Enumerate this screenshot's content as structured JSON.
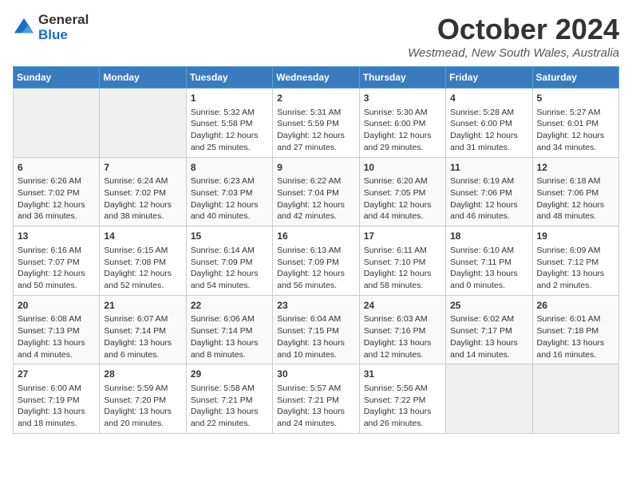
{
  "logo": {
    "general": "General",
    "blue": "Blue"
  },
  "title": "October 2024",
  "location": "Westmead, New South Wales, Australia",
  "days_of_week": [
    "Sunday",
    "Monday",
    "Tuesday",
    "Wednesday",
    "Thursday",
    "Friday",
    "Saturday"
  ],
  "weeks": [
    [
      {
        "day": "",
        "empty": true
      },
      {
        "day": "",
        "empty": true
      },
      {
        "day": "1",
        "sunrise": "Sunrise: 5:32 AM",
        "sunset": "Sunset: 5:58 PM",
        "daylight": "Daylight: 12 hours and 25 minutes."
      },
      {
        "day": "2",
        "sunrise": "Sunrise: 5:31 AM",
        "sunset": "Sunset: 5:59 PM",
        "daylight": "Daylight: 12 hours and 27 minutes."
      },
      {
        "day": "3",
        "sunrise": "Sunrise: 5:30 AM",
        "sunset": "Sunset: 6:00 PM",
        "daylight": "Daylight: 12 hours and 29 minutes."
      },
      {
        "day": "4",
        "sunrise": "Sunrise: 5:28 AM",
        "sunset": "Sunset: 6:00 PM",
        "daylight": "Daylight: 12 hours and 31 minutes."
      },
      {
        "day": "5",
        "sunrise": "Sunrise: 5:27 AM",
        "sunset": "Sunset: 6:01 PM",
        "daylight": "Daylight: 12 hours and 34 minutes."
      }
    ],
    [
      {
        "day": "6",
        "sunrise": "Sunrise: 6:26 AM",
        "sunset": "Sunset: 7:02 PM",
        "daylight": "Daylight: 12 hours and 36 minutes."
      },
      {
        "day": "7",
        "sunrise": "Sunrise: 6:24 AM",
        "sunset": "Sunset: 7:02 PM",
        "daylight": "Daylight: 12 hours and 38 minutes."
      },
      {
        "day": "8",
        "sunrise": "Sunrise: 6:23 AM",
        "sunset": "Sunset: 7:03 PM",
        "daylight": "Daylight: 12 hours and 40 minutes."
      },
      {
        "day": "9",
        "sunrise": "Sunrise: 6:22 AM",
        "sunset": "Sunset: 7:04 PM",
        "daylight": "Daylight: 12 hours and 42 minutes."
      },
      {
        "day": "10",
        "sunrise": "Sunrise: 6:20 AM",
        "sunset": "Sunset: 7:05 PM",
        "daylight": "Daylight: 12 hours and 44 minutes."
      },
      {
        "day": "11",
        "sunrise": "Sunrise: 6:19 AM",
        "sunset": "Sunset: 7:06 PM",
        "daylight": "Daylight: 12 hours and 46 minutes."
      },
      {
        "day": "12",
        "sunrise": "Sunrise: 6:18 AM",
        "sunset": "Sunset: 7:06 PM",
        "daylight": "Daylight: 12 hours and 48 minutes."
      }
    ],
    [
      {
        "day": "13",
        "sunrise": "Sunrise: 6:16 AM",
        "sunset": "Sunset: 7:07 PM",
        "daylight": "Daylight: 12 hours and 50 minutes."
      },
      {
        "day": "14",
        "sunrise": "Sunrise: 6:15 AM",
        "sunset": "Sunset: 7:08 PM",
        "daylight": "Daylight: 12 hours and 52 minutes."
      },
      {
        "day": "15",
        "sunrise": "Sunrise: 6:14 AM",
        "sunset": "Sunset: 7:09 PM",
        "daylight": "Daylight: 12 hours and 54 minutes."
      },
      {
        "day": "16",
        "sunrise": "Sunrise: 6:13 AM",
        "sunset": "Sunset: 7:09 PM",
        "daylight": "Daylight: 12 hours and 56 minutes."
      },
      {
        "day": "17",
        "sunrise": "Sunrise: 6:11 AM",
        "sunset": "Sunset: 7:10 PM",
        "daylight": "Daylight: 12 hours and 58 minutes."
      },
      {
        "day": "18",
        "sunrise": "Sunrise: 6:10 AM",
        "sunset": "Sunset: 7:11 PM",
        "daylight": "Daylight: 13 hours and 0 minutes."
      },
      {
        "day": "19",
        "sunrise": "Sunrise: 6:09 AM",
        "sunset": "Sunset: 7:12 PM",
        "daylight": "Daylight: 13 hours and 2 minutes."
      }
    ],
    [
      {
        "day": "20",
        "sunrise": "Sunrise: 6:08 AM",
        "sunset": "Sunset: 7:13 PM",
        "daylight": "Daylight: 13 hours and 4 minutes."
      },
      {
        "day": "21",
        "sunrise": "Sunrise: 6:07 AM",
        "sunset": "Sunset: 7:14 PM",
        "daylight": "Daylight: 13 hours and 6 minutes."
      },
      {
        "day": "22",
        "sunrise": "Sunrise: 6:06 AM",
        "sunset": "Sunset: 7:14 PM",
        "daylight": "Daylight: 13 hours and 8 minutes."
      },
      {
        "day": "23",
        "sunrise": "Sunrise: 6:04 AM",
        "sunset": "Sunset: 7:15 PM",
        "daylight": "Daylight: 13 hours and 10 minutes."
      },
      {
        "day": "24",
        "sunrise": "Sunrise: 6:03 AM",
        "sunset": "Sunset: 7:16 PM",
        "daylight": "Daylight: 13 hours and 12 minutes."
      },
      {
        "day": "25",
        "sunrise": "Sunrise: 6:02 AM",
        "sunset": "Sunset: 7:17 PM",
        "daylight": "Daylight: 13 hours and 14 minutes."
      },
      {
        "day": "26",
        "sunrise": "Sunrise: 6:01 AM",
        "sunset": "Sunset: 7:18 PM",
        "daylight": "Daylight: 13 hours and 16 minutes."
      }
    ],
    [
      {
        "day": "27",
        "sunrise": "Sunrise: 6:00 AM",
        "sunset": "Sunset: 7:19 PM",
        "daylight": "Daylight: 13 hours and 18 minutes."
      },
      {
        "day": "28",
        "sunrise": "Sunrise: 5:59 AM",
        "sunset": "Sunset: 7:20 PM",
        "daylight": "Daylight: 13 hours and 20 minutes."
      },
      {
        "day": "29",
        "sunrise": "Sunrise: 5:58 AM",
        "sunset": "Sunset: 7:21 PM",
        "daylight": "Daylight: 13 hours and 22 minutes."
      },
      {
        "day": "30",
        "sunrise": "Sunrise: 5:57 AM",
        "sunset": "Sunset: 7:21 PM",
        "daylight": "Daylight: 13 hours and 24 minutes."
      },
      {
        "day": "31",
        "sunrise": "Sunrise: 5:56 AM",
        "sunset": "Sunset: 7:22 PM",
        "daylight": "Daylight: 13 hours and 26 minutes."
      },
      {
        "day": "",
        "empty": true
      },
      {
        "day": "",
        "empty": true
      }
    ]
  ]
}
